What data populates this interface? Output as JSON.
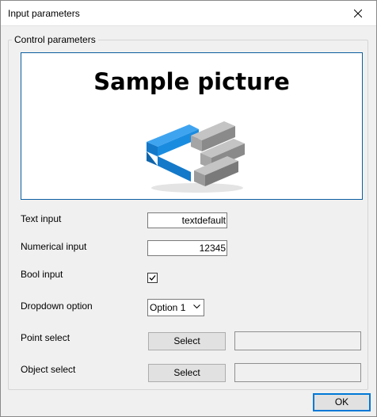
{
  "window": {
    "title": "Input parameters"
  },
  "group": {
    "label": "Control parameters"
  },
  "picture": {
    "text": "Sample picture",
    "logo_icon": "stacked-blocks-logo-icon"
  },
  "text_input": {
    "label": "Text input",
    "value": "textdefault"
  },
  "numerical_input": {
    "label": "Numerical input",
    "value": "12345"
  },
  "bool_input": {
    "label": "Bool input",
    "checked": true
  },
  "dropdown": {
    "label": "Dropdown option",
    "selected": "Option 1"
  },
  "point_select": {
    "label": "Point select",
    "button": "Select",
    "value": ""
  },
  "object_select": {
    "label": "Object select",
    "button": "Select",
    "value": ""
  },
  "footer": {
    "ok_label": "OK"
  },
  "colors": {
    "accent": "#0078d7",
    "logo_blue": "#1a8ce0",
    "logo_gray": "#8a8a8a"
  }
}
